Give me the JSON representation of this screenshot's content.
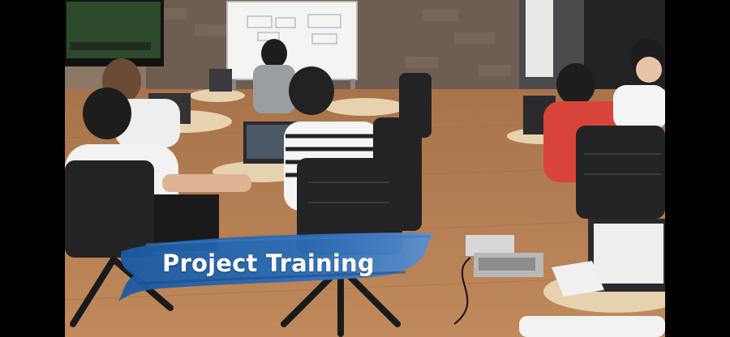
{
  "caption": "Project Training",
  "colors": {
    "caption_brush": "#1f5fa8",
    "caption_text": "#ffffff",
    "letterbox": "#000000"
  }
}
